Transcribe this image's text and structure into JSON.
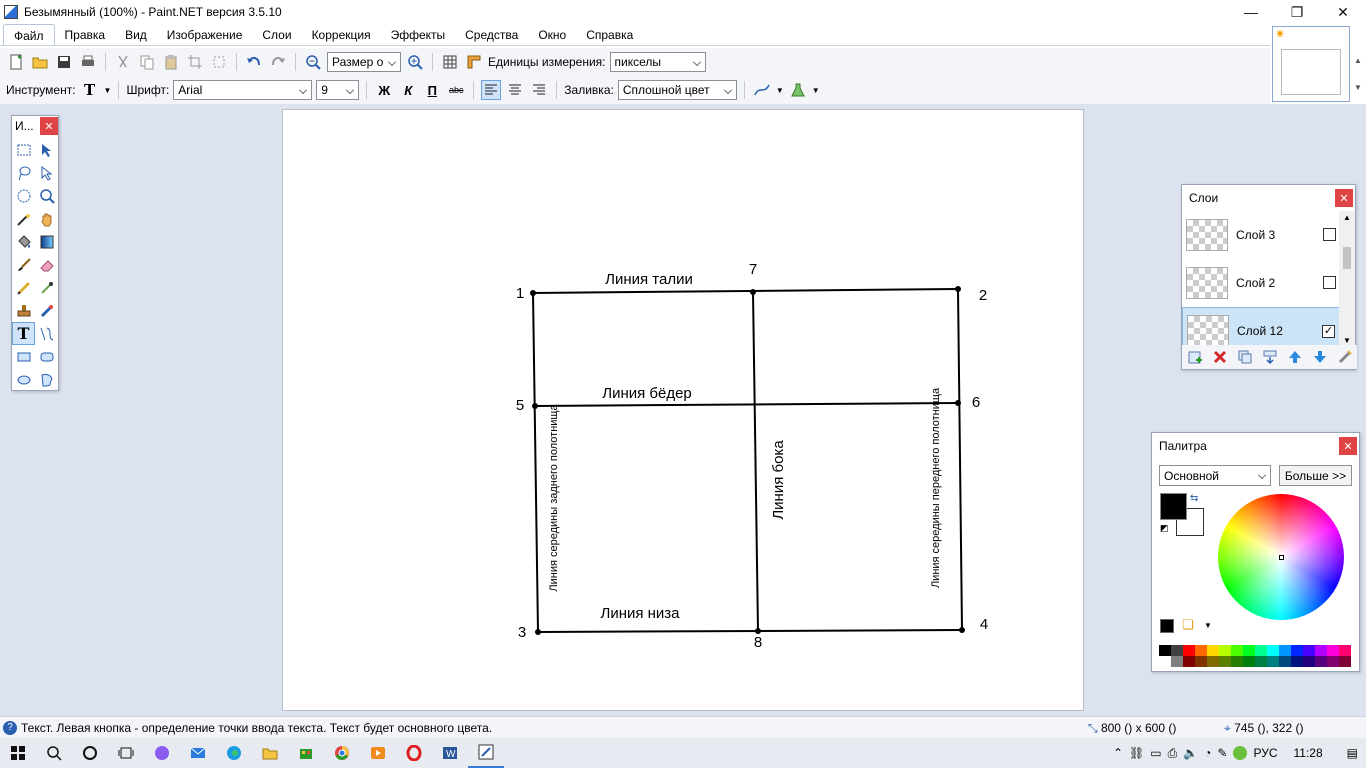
{
  "window": {
    "title": "Безымянный (100%) - Paint.NET версия 3.5.10",
    "controls": [
      "—",
      "❐",
      "✕"
    ]
  },
  "menu": [
    "Файл",
    "Правка",
    "Вид",
    "Изображение",
    "Слои",
    "Коррекция",
    "Эффекты",
    "Средства",
    "Окно",
    "Справка"
  ],
  "toolbar1": {
    "zoom_value": "Размер о",
    "units_label": "Единицы измерения:",
    "units_value": "пикселы"
  },
  "toolbar2": {
    "tool_label": "Инструмент:",
    "font_label": "Шрифт:",
    "font_value": "Arial",
    "size_value": "9",
    "bold": "Ж",
    "italic": "К",
    "underline": "П",
    "strike": "abc",
    "fill_label": "Заливка:",
    "fill_value": "Сплошной цвет"
  },
  "tools_window": {
    "title": "И..."
  },
  "layers_window": {
    "title": "Слои",
    "layers": [
      {
        "name": "Слой 3",
        "checked": ""
      },
      {
        "name": "Слой 2",
        "checked": ""
      },
      {
        "name": "Слой 12",
        "checked": "✓"
      }
    ]
  },
  "palette_window": {
    "title": "Палитра",
    "mode": "Основной",
    "more_button": "Больше >>",
    "swatches": [
      "#000000",
      "#404040",
      "#ff0000",
      "#ff6a00",
      "#ffd800",
      "#b6ff00",
      "#4cff00",
      "#00ff21",
      "#00ff90",
      "#00ffff",
      "#0094ff",
      "#0026ff",
      "#4800ff",
      "#b200ff",
      "#ff00dc",
      "#ff006e",
      "#ffffff",
      "#808080",
      "#7f0000",
      "#7f3300",
      "#7f6a00",
      "#5b7f00",
      "#267f00",
      "#007f0e",
      "#007f46",
      "#007f7f",
      "#004a7f",
      "#00137f",
      "#21007f",
      "#57007f",
      "#7f006e",
      "#7f0037"
    ]
  },
  "drawing": {
    "labels": {
      "waist": "Линия талии",
      "hips": "Линия бёдер",
      "hem": "Линия низа",
      "side": "Линия бока",
      "back_center": "Линия середины заднего полотнища",
      "front_center": "Линия середины переднего полотнища"
    },
    "points": [
      "1",
      "2",
      "3",
      "4",
      "5",
      "6",
      "7",
      "8"
    ]
  },
  "status": {
    "text": "Текст. Левая кнопка - определение точки ввода текста. Текст будет основного цвета.",
    "size": "800 () x 600 ()",
    "position": "745 (), 322 ()"
  },
  "taskbar": {
    "lang": "РУС",
    "time": "11:28"
  }
}
